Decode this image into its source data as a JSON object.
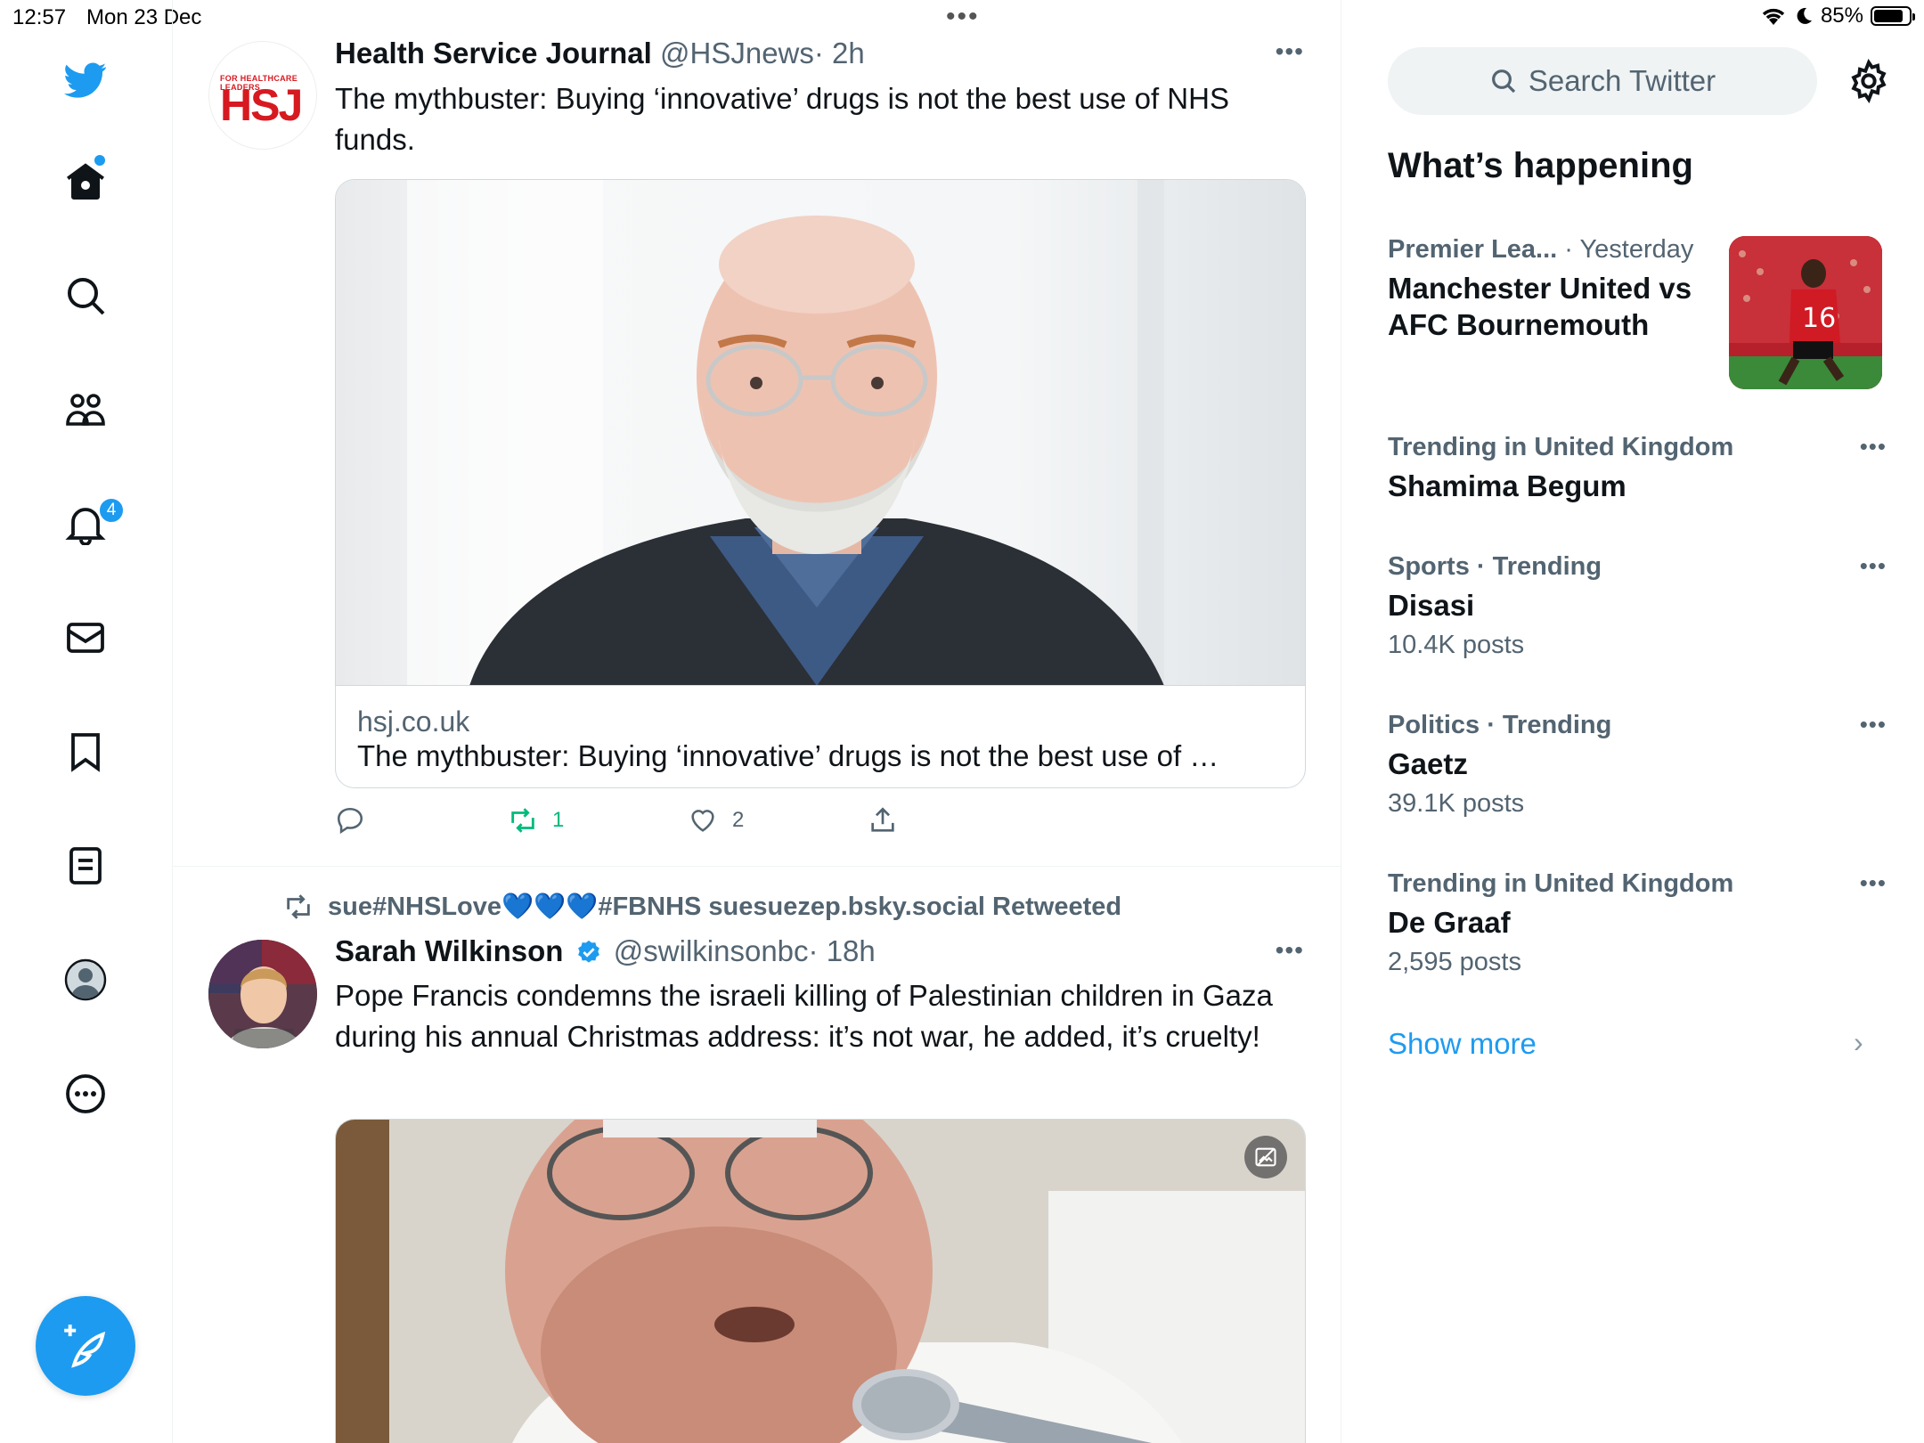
{
  "status_bar": {
    "time": "12:57",
    "date": "Mon 23 Dec",
    "battery": "85%",
    "battery_level": 0.85
  },
  "nav": {
    "notifications_badge": "4",
    "icons": [
      "twitter-logo-icon",
      "home-icon",
      "search-icon",
      "communities-icon",
      "bell-icon",
      "mail-icon",
      "bookmark-icon",
      "lists-icon",
      "profile-icon",
      "more-icon",
      "compose-icon"
    ]
  },
  "timeline": {
    "tweets": [
      {
        "name": "Health Service Journal",
        "handle": "@HSJnews",
        "time": "· 2h",
        "avatar_text": "HSJ",
        "avatar_tagline": "FOR HEALTHCARE LEADERS",
        "text": "The mythbuster: Buying ‘innovative’ drugs is not the best use of NHS funds.",
        "card": {
          "domain": "hsj.co.uk",
          "title": "The mythbuster: Buying ‘innovative’ drugs is not the best use of …"
        },
        "retweets": "1",
        "likes": "2"
      },
      {
        "retweeted_by": "sue#NHSLove💙💙💙#FBNHS suesuezep.bsky.social Retweeted",
        "name": "Sarah Wilkinson",
        "handle": "@swilkinsonbc",
        "time": "· 18h",
        "text": "Pope Francis condemns the israeli killing of Palestinian children in Gaza during his annual Christmas address: it’s not war, he added, it’s cruelty!"
      }
    ]
  },
  "sidebar": {
    "search_placeholder": "Search Twitter",
    "section_title": "What’s happening",
    "trends": [
      {
        "category": "Premier Lea...",
        "time": "· Yesterday",
        "topic": "Manchester United vs AFC Bournemouth"
      },
      {
        "category": "Trending in United Kingdom",
        "topic": "Shamima Begum"
      },
      {
        "category": "Sports · Trending",
        "topic": "Disasi",
        "count": "10.4K posts"
      },
      {
        "category": "Politics · Trending",
        "topic": "Gaetz",
        "count": "39.1K posts"
      },
      {
        "category": "Trending in United Kingdom",
        "topic": "De Graaf",
        "count": "2,595 posts"
      }
    ],
    "show_more": "Show more"
  },
  "colors": {
    "accent": "#1d9bf0",
    "retweet_green": "#00ba7c",
    "secondary_text": "#536471",
    "hsj_red": "#d71920"
  }
}
